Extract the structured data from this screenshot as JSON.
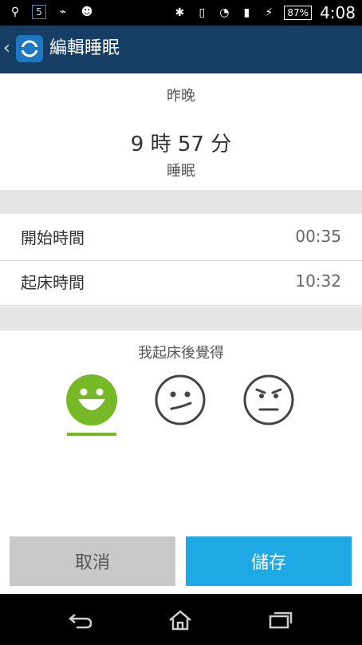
{
  "status_bar": {
    "notification_badge": "5",
    "battery": "87%",
    "time": "4:08",
    "left_icons": [
      "usb-icon",
      "calendar-icon",
      "broom-icon",
      "android-icon"
    ],
    "right_icons": [
      "bluetooth-icon",
      "vibrate-icon",
      "wifi-icon",
      "signal-icon",
      "charging-icon"
    ]
  },
  "action_bar": {
    "title": "編輯睡眠"
  },
  "summary": {
    "period": "昨晚",
    "duration": "9 時 57 分",
    "duration_label": "睡眠"
  },
  "times": {
    "start_label": "開始時間",
    "start_value": "00:35",
    "wake_label": "起床時間",
    "wake_value": "10:32"
  },
  "mood": {
    "prompt": "我起床後覺得",
    "selected": "happy",
    "options": [
      "happy",
      "neutral",
      "annoyed"
    ],
    "accent_color": "#77b827"
  },
  "buttons": {
    "cancel_label": "取消",
    "save_label": "儲存"
  }
}
